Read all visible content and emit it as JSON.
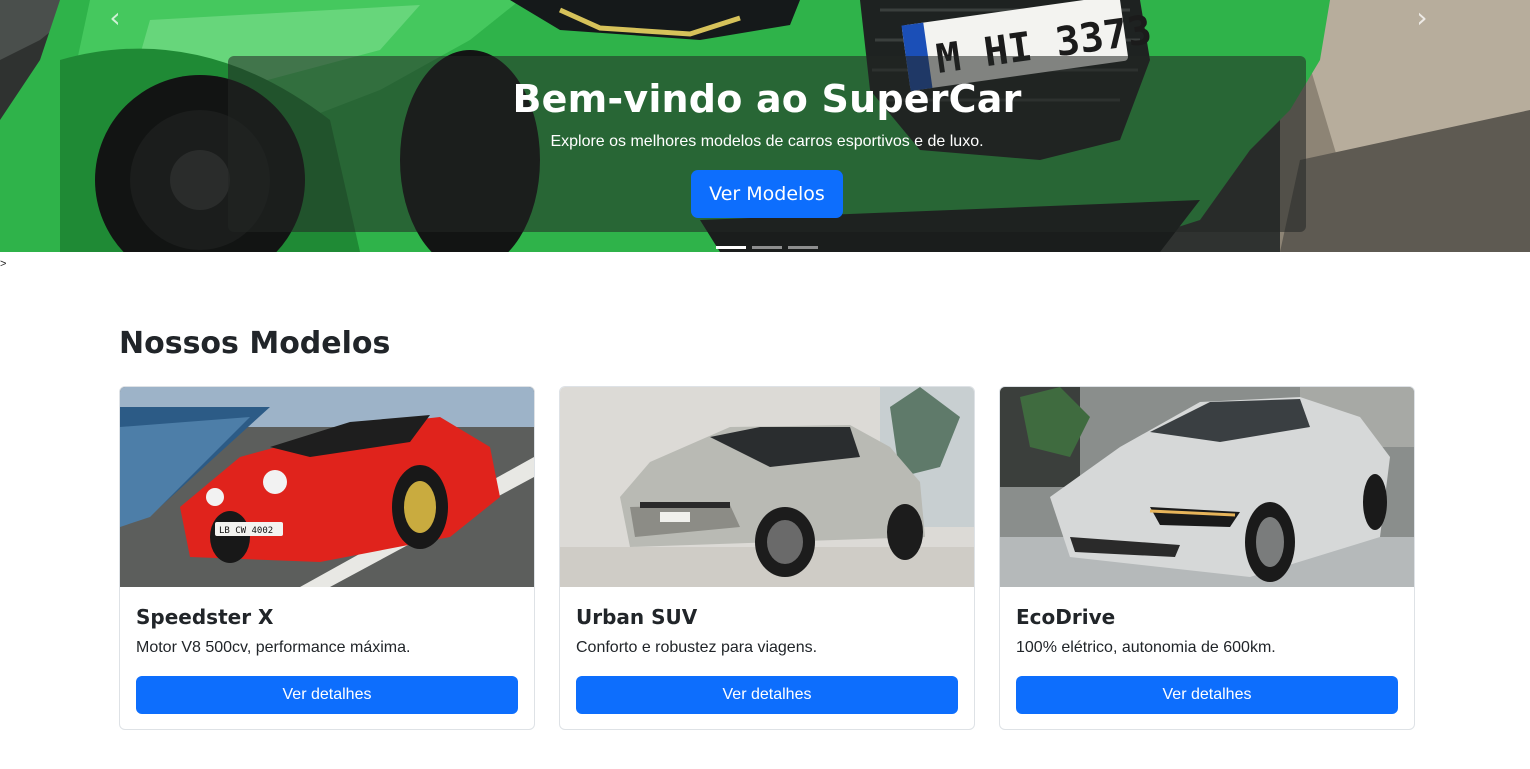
{
  "hero": {
    "title": "Bem-vindo ao SuperCar",
    "subtitle": "Explore os melhores modelos de carros esportivos e de luxo.",
    "cta_label": "Ver Modelos",
    "plate_text": "M HI 3373",
    "prev_icon": "chevron-left-icon",
    "next_icon": "chevron-right-icon",
    "prev_glyph": "‹",
    "next_glyph": "›",
    "slides": 3,
    "active_slide": 1,
    "car_color": "#2fb34a"
  },
  "stray_text": ">",
  "models": {
    "title": "Nossos Modelos",
    "cards": [
      {
        "name": "Speedster X",
        "description": "Motor V8 500cv, performance máxima.",
        "button_label": "Ver detalhes",
        "plate_text": "LB CW 4002",
        "car_color": "#e0231c"
      },
      {
        "name": "Urban SUV",
        "description": "Conforto e robustez para viagens.",
        "button_label": "Ver detalhes",
        "car_color": "#b9bab4"
      },
      {
        "name": "EcoDrive",
        "description": "100% elétrico, autonomia de 600km.",
        "button_label": "Ver detalhes",
        "car_color": "#d6d8d8"
      }
    ]
  },
  "colors": {
    "primary": "#0d6efd",
    "text": "#212529",
    "border": "#dee2e6"
  }
}
